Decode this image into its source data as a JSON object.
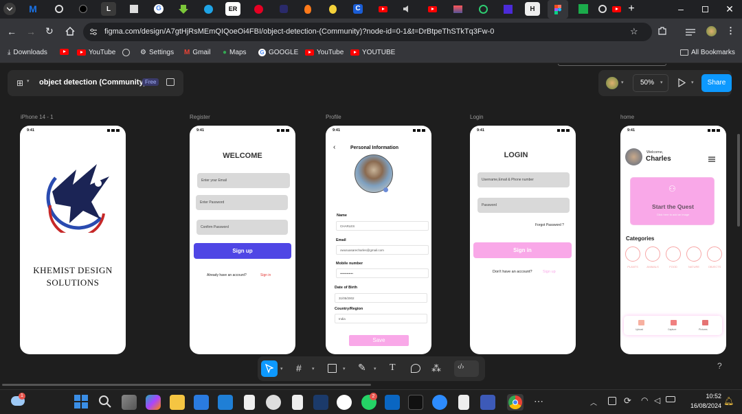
{
  "browser": {
    "url": "figma.com/design/A7gtHjRsMEmQIQoeOi4FBI/object-detection-(Community)?node-id=0-1&t=DrBtpeThSTkTq3Fw-0",
    "tab_letters": [
      "M",
      "L",
      "G",
      "ER",
      "C",
      "H"
    ],
    "bookmarks": [
      "Downloads",
      "YouTube",
      "Settings",
      "Gmail",
      "Maps",
      "GOOGLE",
      "YouTube",
      "YOUTUBE"
    ],
    "all_bookmarks": "All Bookmarks"
  },
  "figma": {
    "file_name": "object detection (Community)",
    "badge": "Free",
    "zoom": "50%",
    "share_label": "Share",
    "help": "?"
  },
  "frames": {
    "labels": [
      "iPhone 14 - 1",
      "Register",
      "Profile",
      "Login",
      "home"
    ],
    "time": "9:41"
  },
  "splash": {
    "company_line1": "KHEMIST DESIGN",
    "company_line2": "SOLUTIONS"
  },
  "register": {
    "title": "WELCOME",
    "email_placeholder": "Enter your Email",
    "password_placeholder": "Enter Password",
    "confirm_placeholder": "Confirm Password",
    "signup_label": "Sign up",
    "have_account": "Already have an account?",
    "signin_link": "Sign in"
  },
  "profile": {
    "title": "Personal Information",
    "name_label": "Name",
    "name_value": "CHARLES",
    "email_label": "Email",
    "email_value": "owusuasarecharles@gmail.com",
    "mobile_label": "Mobile number",
    "mobile_value": "••••••••••••",
    "dob_label": "Date of Birth",
    "dob_value": "31/05/2002",
    "country_label": "Country/Region",
    "country_value": "India",
    "save_label": "Save"
  },
  "login": {
    "title": "LOGIN",
    "user_placeholder": "Username,Email & Phone number",
    "password_placeholder": "Password",
    "forgot": "Forgot Password ?",
    "signin_label": "Sign in",
    "no_account": "Don't have an account?",
    "signup_link": "Sign up"
  },
  "home": {
    "welcome": "Welcome,",
    "user": "Charles",
    "quest_title": "Start the Quest",
    "quest_sub": "Click here to add an image",
    "categories_title": "Categories",
    "categories": [
      "PLANTS",
      "ANIMALS",
      "FOOD",
      "NATURE",
      "OBJECTS"
    ],
    "nav": [
      "Upload",
      "Capture",
      "Pictures"
    ]
  },
  "taskbar": {
    "time": "10:52",
    "date": "16/08/2024",
    "weather_badge": "1",
    "whatsapp_badge": "2"
  },
  "colors": {
    "primary_purple": "#4f46e5",
    "pink": "#f9a8e8",
    "figma_blue": "#0d99ff"
  }
}
